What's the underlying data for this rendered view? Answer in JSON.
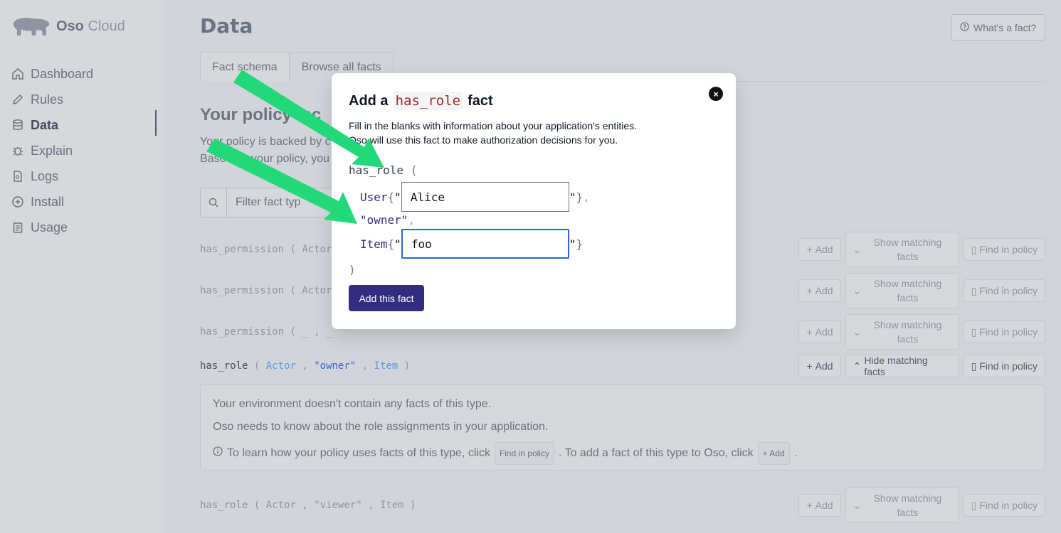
{
  "brand": {
    "name_bold": "Oso",
    "name_light": "Cloud"
  },
  "nav": [
    {
      "label": "Dashboard",
      "icon": "home-icon",
      "active": false
    },
    {
      "label": "Rules",
      "icon": "pencil-icon",
      "active": false
    },
    {
      "label": "Data",
      "icon": "database-icon",
      "active": true
    },
    {
      "label": "Explain",
      "icon": "bug-icon",
      "active": false
    },
    {
      "label": "Logs",
      "icon": "document-search-icon",
      "active": false
    },
    {
      "label": "Install",
      "icon": "plus-circle-icon",
      "active": false
    },
    {
      "label": "Usage",
      "icon": "clipboard-icon",
      "active": false
    }
  ],
  "header": {
    "title": "Data",
    "whats_fact": "What's a fact?"
  },
  "tabs": [
    {
      "label": "Fact schema",
      "active": true
    },
    {
      "label": "Browse all facts",
      "active": false
    }
  ],
  "section": {
    "title": "Your policy",
    "title_tail": "fac",
    "desc_line1": "Your policy is backed by c",
    "desc_line2": "Based on your policy, you"
  },
  "filter": {
    "placeholder": "Filter fact typ"
  },
  "buttons": {
    "add": "Add",
    "show_matching_1": "Show matching",
    "show_matching_2": "facts",
    "hide_matching": "Hide matching facts",
    "find_in_policy": "Find in policy"
  },
  "fact_rows": [
    {
      "name": "has_permission",
      "args_visible": "Actor"
    },
    {
      "name": "has_permission",
      "args_visible": "Actor"
    },
    {
      "name": "has_permission",
      "args_visible": "_ , _"
    },
    {
      "name": "has_role",
      "arg1": "Actor",
      "arg2": "\"owner\"",
      "arg3": "Item"
    },
    {
      "name": "has_role",
      "arg1": "Actor",
      "arg2": "\"viewer\"",
      "arg3": "Item"
    }
  ],
  "empty_box": {
    "line1": "Your environment doesn't contain any facts of this type.",
    "line2": "Oso needs to know about the role assignments in your application.",
    "line3_a": "To learn how your policy uses facts of this type, click",
    "line3_btn1": "Find in policy",
    "line3_b": ". To add a fact of this type to Oso, click",
    "line3_btn2": "+ Add",
    "line3_c": "."
  },
  "modal": {
    "title_prefix": "Add a",
    "title_code": "has_role",
    "title_suffix": "fact",
    "desc_line1": "Fill in the blanks with information about your application's entities.",
    "desc_line2": "Oso will use this fact to make authorization decisions for you.",
    "fn_name": "has_role",
    "open_paren": "(",
    "close_paren": ")",
    "arg1_type": "User",
    "arg1_value": "Alice",
    "arg2_literal": "\"owner\"",
    "arg3_type": "Item",
    "arg3_value": "foo",
    "submit": "Add this fact"
  },
  "colors": {
    "accent": "#312e81",
    "annotation_arrow": "#22d97a",
    "focus": "#2563eb"
  }
}
